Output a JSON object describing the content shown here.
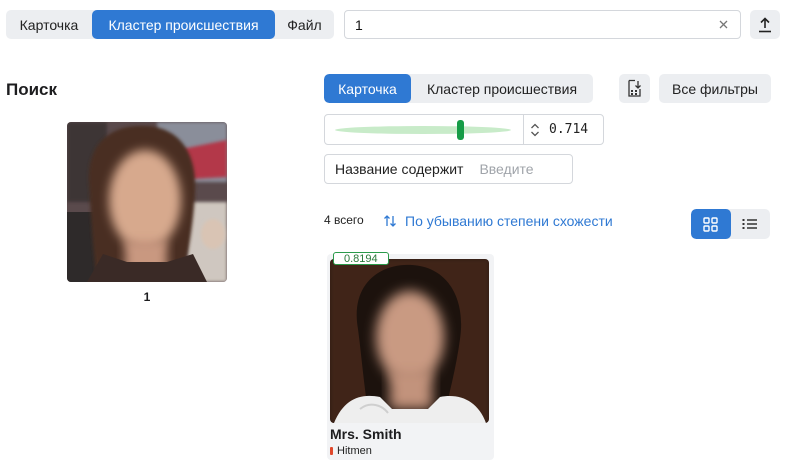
{
  "top_tabs": {
    "items": [
      {
        "label": "Карточка"
      },
      {
        "label": "Кластер происшествия"
      },
      {
        "label": "Файл"
      }
    ],
    "active_index": 1
  },
  "search": {
    "value": "1"
  },
  "left_panel": {
    "title": "Поиск",
    "query_caption": "1"
  },
  "result_tabs": {
    "items": [
      {
        "label": "Карточка"
      },
      {
        "label": "Кластер происшествия"
      }
    ],
    "active_index": 0
  },
  "all_filters_label": "Все фильтры",
  "similarity": {
    "value": "0.714",
    "fraction": 0.714
  },
  "name_filter": {
    "label": "Название содержит",
    "placeholder": "Введите"
  },
  "results": {
    "total_label": "4 всего",
    "sort_label": "По убыванию степени схожести",
    "view_mode": "grid"
  },
  "cards": [
    {
      "score": "0.8194",
      "name": "Mrs. Smith",
      "tag": "Hitmen",
      "tag_color": "#e0482c"
    }
  ],
  "colors": {
    "accent": "#2f79d3",
    "slider_thumb": "#169c47",
    "slider_track": "#c8ebc9"
  }
}
